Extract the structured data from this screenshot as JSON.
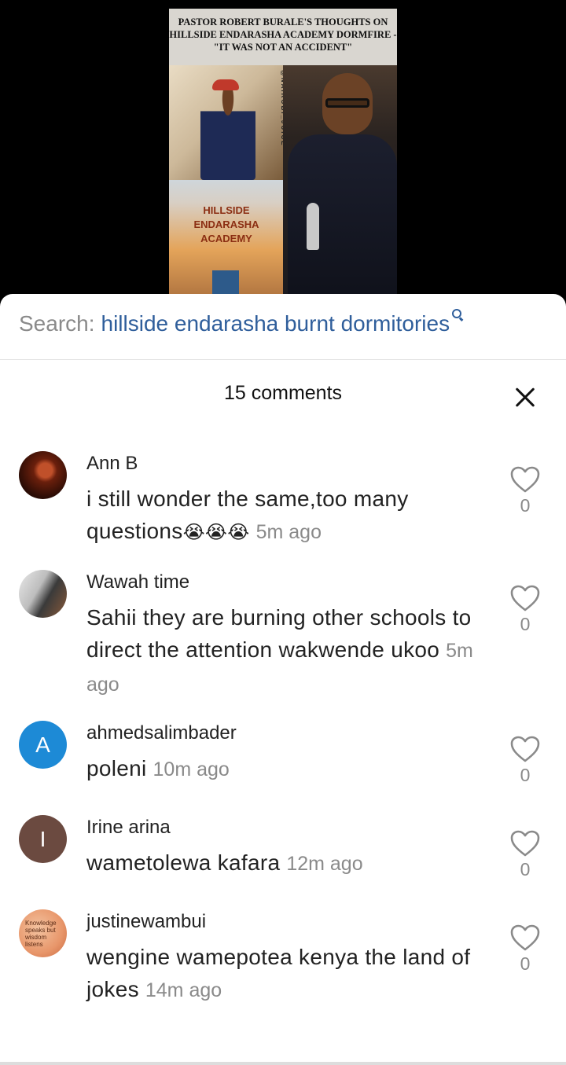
{
  "video": {
    "title": "PASTOR ROBERT BURALE'S THOUGHTS ON HILLSIDE ENDARASHA ACADEMY DORMFIRE - \"IT WAS NOT AN ACCIDENT\"",
    "watermark": "@NAIROBI_JUICE",
    "sign_text": "HILLSIDE ENDARASHA ACADEMY"
  },
  "search": {
    "label": "Search:",
    "query": "hillside endarasha burnt dormitories"
  },
  "header": {
    "comments_count": "15 comments"
  },
  "comments": [
    {
      "username": "Ann B",
      "text": "i still wonder the same,too many questions",
      "emoji": "😭😭😭",
      "time": "5m ago",
      "likes": "0",
      "avatar_initial": "",
      "avatar_color": "#4a1a0d"
    },
    {
      "username": "Wawah time",
      "text": "Sahii they are burning other schools to direct the attention wakwende ukoo",
      "emoji": "",
      "time": "5m ago",
      "likes": "0",
      "avatar_initial": "",
      "avatar_color": "#cfcfcf"
    },
    {
      "username": "ahmedsalimbader",
      "text": "poleni",
      "emoji": "",
      "time": "10m ago",
      "likes": "0",
      "avatar_initial": "A",
      "avatar_color": "#1d8ad6"
    },
    {
      "username": "Irine arina",
      "text": "wametolewa kafara",
      "emoji": "",
      "time": "12m ago",
      "likes": "0",
      "avatar_initial": "I",
      "avatar_color": "#6b4a40"
    },
    {
      "username": "justinewambui",
      "text": "wengine wamepotea kenya the land of jokes",
      "emoji": "",
      "time": "14m ago",
      "likes": "0",
      "avatar_initial": "",
      "avatar_color": "#e8a07a"
    }
  ],
  "colors": {
    "accent": "#2f5e9b",
    "muted": "#8a8a8a"
  }
}
